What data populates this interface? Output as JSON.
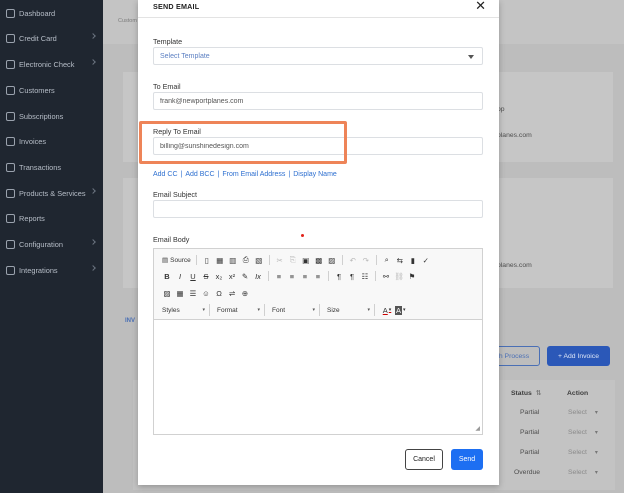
{
  "sidebar": {
    "items": [
      {
        "label": "Dashboard",
        "icon": "home-icon",
        "expandable": false
      },
      {
        "label": "Credit Card",
        "icon": "credit-card-icon",
        "expandable": true
      },
      {
        "label": "Electronic Check",
        "icon": "check-icon",
        "expandable": true
      },
      {
        "label": "Customers",
        "icon": "users-icon",
        "expandable": false
      },
      {
        "label": "Subscriptions",
        "icon": "refresh-icon",
        "expandable": false
      },
      {
        "label": "Invoices",
        "icon": "invoice-icon",
        "expandable": false
      },
      {
        "label": "Transactions",
        "icon": "dollar-icon",
        "expandable": false
      },
      {
        "label": "Products & Services",
        "icon": "box-icon",
        "expandable": true
      },
      {
        "label": "Reports",
        "icon": "bar-chart-icon",
        "expandable": false
      },
      {
        "label": "Configuration",
        "icon": "gear-icon",
        "expandable": true
      },
      {
        "label": "Integrations",
        "icon": "plug-icon",
        "expandable": true
      }
    ]
  },
  "background": {
    "breadcrumb": "Custom",
    "partial_text_1": "op",
    "partial_text_2": "planes.com",
    "partial_text_3": "planes.com",
    "tab_label": "INV",
    "batch_process_label": "h Process",
    "add_invoice_label": "+ Add Invoice",
    "table": {
      "status_header": "Status",
      "sort_icon": "⇅",
      "action_header": "Action",
      "rows": [
        {
          "status": "Partial",
          "action": "Select"
        },
        {
          "status": "Partial",
          "action": "Select"
        },
        {
          "status": "Partial",
          "action": "Select"
        },
        {
          "status": "Overdue",
          "action": "Select"
        }
      ]
    }
  },
  "modal": {
    "title": "SEND EMAIL",
    "close_glyph": "✕",
    "template": {
      "label": "Template",
      "value": "Select Template"
    },
    "to_email": {
      "label": "To Email",
      "value": "frank@newportplanes.com"
    },
    "reply_to": {
      "label": "Reply To Email",
      "value": "billing@sunshinedesign.com"
    },
    "highlight_color": "#ee8458",
    "links": [
      "Add CC",
      "Add BCC",
      "From Email Address",
      "Display Name"
    ],
    "link_separator": "|",
    "subject": {
      "label": "Email Subject",
      "value": ""
    },
    "body": {
      "label": "Email Body",
      "value": ""
    },
    "editor": {
      "source_label": "Source",
      "styles_label": "Styles",
      "format_label": "Format",
      "font_label": "Font",
      "size_label": "Size",
      "combo_caret": "▾",
      "grip_glyph": "◢",
      "row1_glyphs": [
        "▤",
        "▯",
        "▦",
        "▥",
        "⎙",
        "▧",
        "✂",
        "⎘",
        "▣",
        "▩",
        "▨",
        "↶",
        "↷",
        "⌕",
        "⇆",
        "▮",
        "✓"
      ],
      "row2_glyphs": [
        "B",
        "I",
        "U",
        "S",
        "x₂",
        "x²",
        "✎",
        "Ix",
        "≡",
        "≡",
        "≡",
        "≡",
        "¶",
        "¶",
        "☷",
        "⚯",
        "⛓",
        "⚑"
      ],
      "row3_glyphs": [
        "▨",
        "▦",
        "☰",
        "☺",
        "Ω",
        "⇌",
        "⊕"
      ],
      "text_color_glyph": "A",
      "bg_color_glyph": "A"
    },
    "cancel_label": "Cancel",
    "send_label": "Send",
    "send_color": "#1d6ff2"
  }
}
